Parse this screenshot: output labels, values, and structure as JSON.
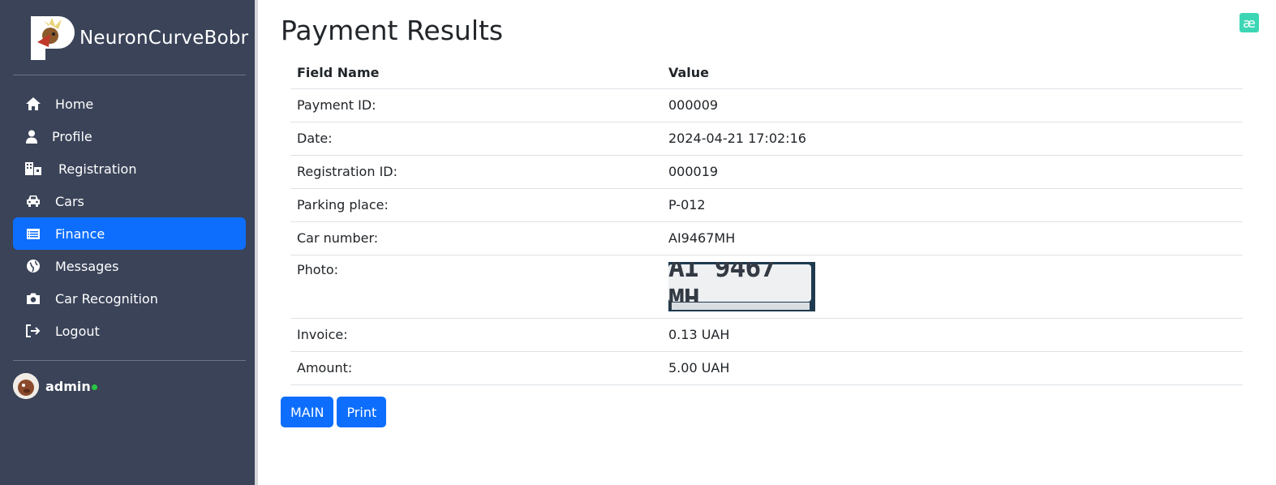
{
  "sidebar": {
    "brand": "NeuronCurveBobr",
    "items": [
      {
        "label": "Home",
        "icon": "home-icon"
      },
      {
        "label": "Profile",
        "icon": "user-icon"
      },
      {
        "label": "Registration",
        "icon": "building-icon"
      },
      {
        "label": "Cars",
        "icon": "car-icon"
      },
      {
        "label": "Finance",
        "icon": "table-list-icon",
        "active": true
      },
      {
        "label": "Messages",
        "icon": "globe-icon"
      },
      {
        "label": "Car Recognition",
        "icon": "camera-icon"
      },
      {
        "label": "Logout",
        "icon": "logout-icon"
      }
    ],
    "user": {
      "name": "admin",
      "status_color": "#28c840"
    }
  },
  "main": {
    "title": "Payment Results",
    "table": {
      "headers": [
        "Field Name",
        "Value"
      ],
      "rows": [
        {
          "field": "Payment ID:",
          "value": "000009"
        },
        {
          "field": "Date:",
          "value": "2024-04-21 17:02:16"
        },
        {
          "field": "Registration ID:",
          "value": "000019"
        },
        {
          "field": "Parking place:",
          "value": "P-012"
        },
        {
          "field": "Car number:",
          "value": "AI9467MH"
        },
        {
          "field": "Photo:",
          "value": "AI 9467 MH"
        },
        {
          "field": "Invoice:",
          "value": "0.13 UAH"
        },
        {
          "field": "Amount:",
          "value": "5.00 UAH"
        }
      ]
    },
    "buttons": {
      "main": "MAIN",
      "print": "Print"
    }
  },
  "extension_badge": "æ",
  "colors": {
    "sidebar_bg": "#3a4358",
    "accent": "#0d6efd",
    "badge": "#3dd6b5"
  }
}
